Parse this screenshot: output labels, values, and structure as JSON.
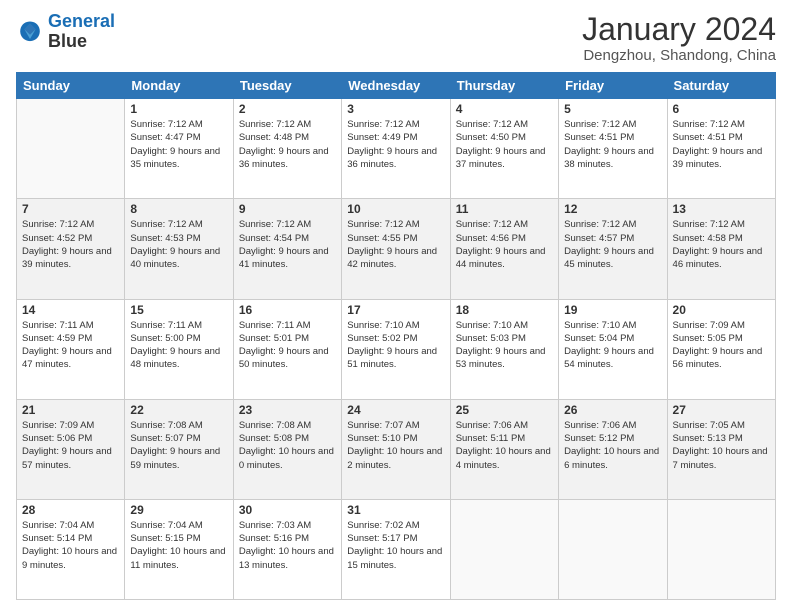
{
  "logo": {
    "line1": "General",
    "line2": "Blue"
  },
  "header": {
    "month": "January 2024",
    "location": "Dengzhou, Shandong, China"
  },
  "weekdays": [
    "Sunday",
    "Monday",
    "Tuesday",
    "Wednesday",
    "Thursday",
    "Friday",
    "Saturday"
  ],
  "weeks": [
    [
      {
        "day": "",
        "sunrise": "",
        "sunset": "",
        "daylight": ""
      },
      {
        "day": "1",
        "sunrise": "Sunrise: 7:12 AM",
        "sunset": "Sunset: 4:47 PM",
        "daylight": "Daylight: 9 hours and 35 minutes."
      },
      {
        "day": "2",
        "sunrise": "Sunrise: 7:12 AM",
        "sunset": "Sunset: 4:48 PM",
        "daylight": "Daylight: 9 hours and 36 minutes."
      },
      {
        "day": "3",
        "sunrise": "Sunrise: 7:12 AM",
        "sunset": "Sunset: 4:49 PM",
        "daylight": "Daylight: 9 hours and 36 minutes."
      },
      {
        "day": "4",
        "sunrise": "Sunrise: 7:12 AM",
        "sunset": "Sunset: 4:50 PM",
        "daylight": "Daylight: 9 hours and 37 minutes."
      },
      {
        "day": "5",
        "sunrise": "Sunrise: 7:12 AM",
        "sunset": "Sunset: 4:51 PM",
        "daylight": "Daylight: 9 hours and 38 minutes."
      },
      {
        "day": "6",
        "sunrise": "Sunrise: 7:12 AM",
        "sunset": "Sunset: 4:51 PM",
        "daylight": "Daylight: 9 hours and 39 minutes."
      }
    ],
    [
      {
        "day": "7",
        "sunrise": "Sunrise: 7:12 AM",
        "sunset": "Sunset: 4:52 PM",
        "daylight": "Daylight: 9 hours and 39 minutes."
      },
      {
        "day": "8",
        "sunrise": "Sunrise: 7:12 AM",
        "sunset": "Sunset: 4:53 PM",
        "daylight": "Daylight: 9 hours and 40 minutes."
      },
      {
        "day": "9",
        "sunrise": "Sunrise: 7:12 AM",
        "sunset": "Sunset: 4:54 PM",
        "daylight": "Daylight: 9 hours and 41 minutes."
      },
      {
        "day": "10",
        "sunrise": "Sunrise: 7:12 AM",
        "sunset": "Sunset: 4:55 PM",
        "daylight": "Daylight: 9 hours and 42 minutes."
      },
      {
        "day": "11",
        "sunrise": "Sunrise: 7:12 AM",
        "sunset": "Sunset: 4:56 PM",
        "daylight": "Daylight: 9 hours and 44 minutes."
      },
      {
        "day": "12",
        "sunrise": "Sunrise: 7:12 AM",
        "sunset": "Sunset: 4:57 PM",
        "daylight": "Daylight: 9 hours and 45 minutes."
      },
      {
        "day": "13",
        "sunrise": "Sunrise: 7:12 AM",
        "sunset": "Sunset: 4:58 PM",
        "daylight": "Daylight: 9 hours and 46 minutes."
      }
    ],
    [
      {
        "day": "14",
        "sunrise": "Sunrise: 7:11 AM",
        "sunset": "Sunset: 4:59 PM",
        "daylight": "Daylight: 9 hours and 47 minutes."
      },
      {
        "day": "15",
        "sunrise": "Sunrise: 7:11 AM",
        "sunset": "Sunset: 5:00 PM",
        "daylight": "Daylight: 9 hours and 48 minutes."
      },
      {
        "day": "16",
        "sunrise": "Sunrise: 7:11 AM",
        "sunset": "Sunset: 5:01 PM",
        "daylight": "Daylight: 9 hours and 50 minutes."
      },
      {
        "day": "17",
        "sunrise": "Sunrise: 7:10 AM",
        "sunset": "Sunset: 5:02 PM",
        "daylight": "Daylight: 9 hours and 51 minutes."
      },
      {
        "day": "18",
        "sunrise": "Sunrise: 7:10 AM",
        "sunset": "Sunset: 5:03 PM",
        "daylight": "Daylight: 9 hours and 53 minutes."
      },
      {
        "day": "19",
        "sunrise": "Sunrise: 7:10 AM",
        "sunset": "Sunset: 5:04 PM",
        "daylight": "Daylight: 9 hours and 54 minutes."
      },
      {
        "day": "20",
        "sunrise": "Sunrise: 7:09 AM",
        "sunset": "Sunset: 5:05 PM",
        "daylight": "Daylight: 9 hours and 56 minutes."
      }
    ],
    [
      {
        "day": "21",
        "sunrise": "Sunrise: 7:09 AM",
        "sunset": "Sunset: 5:06 PM",
        "daylight": "Daylight: 9 hours and 57 minutes."
      },
      {
        "day": "22",
        "sunrise": "Sunrise: 7:08 AM",
        "sunset": "Sunset: 5:07 PM",
        "daylight": "Daylight: 9 hours and 59 minutes."
      },
      {
        "day": "23",
        "sunrise": "Sunrise: 7:08 AM",
        "sunset": "Sunset: 5:08 PM",
        "daylight": "Daylight: 10 hours and 0 minutes."
      },
      {
        "day": "24",
        "sunrise": "Sunrise: 7:07 AM",
        "sunset": "Sunset: 5:10 PM",
        "daylight": "Daylight: 10 hours and 2 minutes."
      },
      {
        "day": "25",
        "sunrise": "Sunrise: 7:06 AM",
        "sunset": "Sunset: 5:11 PM",
        "daylight": "Daylight: 10 hours and 4 minutes."
      },
      {
        "day": "26",
        "sunrise": "Sunrise: 7:06 AM",
        "sunset": "Sunset: 5:12 PM",
        "daylight": "Daylight: 10 hours and 6 minutes."
      },
      {
        "day": "27",
        "sunrise": "Sunrise: 7:05 AM",
        "sunset": "Sunset: 5:13 PM",
        "daylight": "Daylight: 10 hours and 7 minutes."
      }
    ],
    [
      {
        "day": "28",
        "sunrise": "Sunrise: 7:04 AM",
        "sunset": "Sunset: 5:14 PM",
        "daylight": "Daylight: 10 hours and 9 minutes."
      },
      {
        "day": "29",
        "sunrise": "Sunrise: 7:04 AM",
        "sunset": "Sunset: 5:15 PM",
        "daylight": "Daylight: 10 hours and 11 minutes."
      },
      {
        "day": "30",
        "sunrise": "Sunrise: 7:03 AM",
        "sunset": "Sunset: 5:16 PM",
        "daylight": "Daylight: 10 hours and 13 minutes."
      },
      {
        "day": "31",
        "sunrise": "Sunrise: 7:02 AM",
        "sunset": "Sunset: 5:17 PM",
        "daylight": "Daylight: 10 hours and 15 minutes."
      },
      {
        "day": "",
        "sunrise": "",
        "sunset": "",
        "daylight": ""
      },
      {
        "day": "",
        "sunrise": "",
        "sunset": "",
        "daylight": ""
      },
      {
        "day": "",
        "sunrise": "",
        "sunset": "",
        "daylight": ""
      }
    ]
  ]
}
